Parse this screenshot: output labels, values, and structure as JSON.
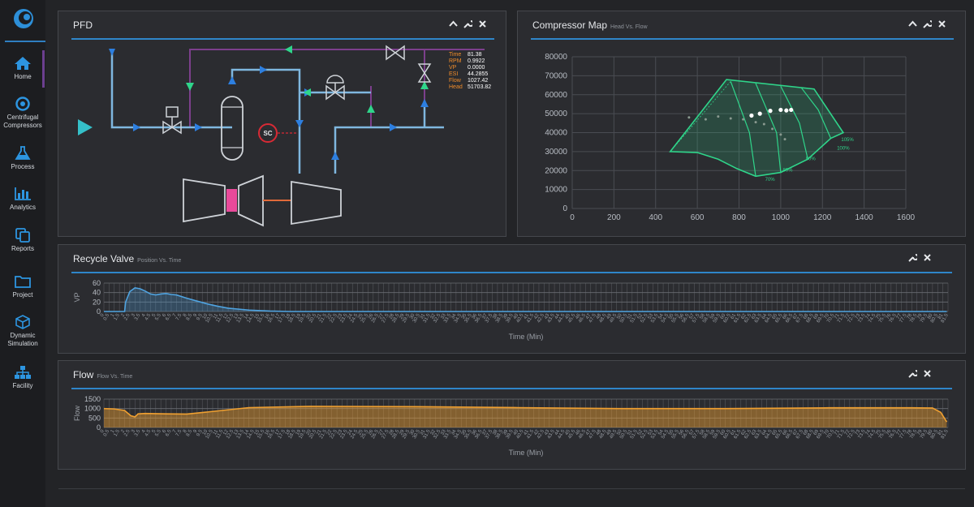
{
  "sidebar": {
    "items": [
      {
        "label": "Home",
        "icon": "home-icon"
      },
      {
        "label": "Centrifugal Compressors",
        "icon": "target-icon"
      },
      {
        "label": "Process",
        "icon": "flask-icon"
      },
      {
        "label": "Analytics",
        "icon": "bar-chart-icon"
      },
      {
        "label": "Reports",
        "icon": "copy-icon"
      },
      {
        "label": "Project",
        "icon": "folder-icon"
      },
      {
        "label": "Dynamic Simulation",
        "icon": "cube-icon"
      },
      {
        "label": "Facility",
        "icon": "hierarchy-icon"
      }
    ],
    "active": "Home",
    "accent": "#2f86c9",
    "active_bar": "#6b3f8f"
  },
  "pfd": {
    "title": "PFD",
    "controller_label": "SC",
    "readout": [
      {
        "label": "Time",
        "value": "81.38"
      },
      {
        "label": "RPM",
        "value": "0.9922"
      },
      {
        "label": "VP",
        "value": "0.0000"
      },
      {
        "label": "ESI",
        "value": "44.2855"
      },
      {
        "label": "Flow",
        "value": "1027.42"
      },
      {
        "label": "Head",
        "value": "51703.82"
      }
    ]
  },
  "compressor_map": {
    "title": "Compressor Map",
    "subtitle": "Head Vs. Flow",
    "chart_data": {
      "type": "scatter",
      "x_ticks": [
        0,
        200,
        400,
        600,
        800,
        1000,
        1200,
        1400,
        1600
      ],
      "y_ticks": [
        0,
        10000,
        20000,
        30000,
        40000,
        50000,
        60000,
        70000,
        80000
      ],
      "xlim": [
        0,
        1600
      ],
      "ylim": [
        0,
        80000
      ],
      "grid": true,
      "speed_line_labels": [
        "70%",
        "80%",
        "90%",
        "100%",
        "105%"
      ],
      "envelope_color": "#2fd58a",
      "operating_points": [
        [
          860,
          49000
        ],
        [
          900,
          50000
        ],
        [
          950,
          51500
        ],
        [
          1000,
          52000
        ],
        [
          1027,
          51700
        ],
        [
          1050,
          52000
        ]
      ],
      "trajectory": [
        [
          560,
          48000
        ],
        [
          640,
          47000
        ],
        [
          700,
          48500
        ],
        [
          760,
          47500
        ],
        [
          820,
          47000
        ],
        [
          880,
          45500
        ],
        [
          920,
          44500
        ],
        [
          960,
          42000
        ],
        [
          1000,
          39000
        ],
        [
          1020,
          36500
        ]
      ]
    }
  },
  "recycle_valve": {
    "title": "Recycle Valve",
    "subtitle": "Position Vs. Time",
    "chart_data": {
      "type": "area",
      "ylabel": "VP",
      "xlabel": "Time (Min)",
      "y_ticks": [
        0,
        20,
        40,
        60
      ],
      "ylim": [
        0,
        60
      ],
      "xlim": [
        0,
        81.5
      ],
      "grid": true,
      "color": "#4fa3e0",
      "x": [
        0,
        2.0,
        2.1,
        2.5,
        3.0,
        3.5,
        4.0,
        4.5,
        5.0,
        5.5,
        6.0,
        6.5,
        7.0,
        8.0,
        9.0,
        10.0,
        11.0,
        12.0,
        14.0,
        16.0,
        18.0,
        20.0,
        81.38
      ],
      "values": [
        0,
        0,
        20,
        42,
        50,
        48,
        43,
        37,
        35,
        37,
        38,
        36,
        35,
        28,
        22,
        16,
        11,
        7,
        3,
        1,
        0,
        0,
        0
      ]
    }
  },
  "flow": {
    "title": "Flow",
    "subtitle": "Flow Vs. Time",
    "chart_data": {
      "type": "area",
      "ylabel": "Flow",
      "xlabel": "Time (Min)",
      "y_ticks": [
        0,
        500,
        1000,
        1500
      ],
      "ylim": [
        0,
        1500
      ],
      "xlim": [
        0,
        81.5
      ],
      "grid": true,
      "color": "#f0a030",
      "x": [
        0,
        1,
        2,
        2.6,
        3.0,
        3.3,
        4,
        6,
        8,
        10,
        14,
        20,
        30,
        40,
        50,
        60,
        70,
        78,
        80,
        80.8,
        81.38
      ],
      "values": [
        1000,
        980,
        900,
        620,
        560,
        720,
        740,
        720,
        710,
        820,
        1050,
        1120,
        1100,
        1050,
        1000,
        1000,
        1040,
        1040,
        1030,
        800,
        290
      ]
    }
  }
}
